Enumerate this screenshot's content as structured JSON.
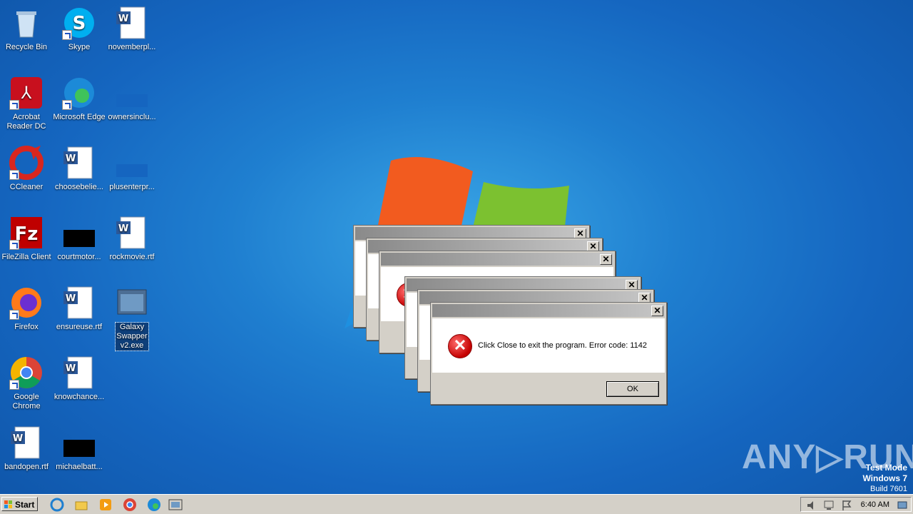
{
  "desktop_icons": [
    {
      "label": "Recycle Bin"
    },
    {
      "label": "Skype"
    },
    {
      "label": "novemberpl..."
    },
    {
      "label": "Acrobat Reader DC"
    },
    {
      "label": "Microsoft Edge"
    },
    {
      "label": "ownersinclu..."
    },
    {
      "label": "CCleaner"
    },
    {
      "label": "choosebelie..."
    },
    {
      "label": "plusenterpr..."
    },
    {
      "label": "FileZilla Client"
    },
    {
      "label": "courtmotor..."
    },
    {
      "label": "rockmovie.rtf"
    },
    {
      "label": "Firefox"
    },
    {
      "label": "ensureuse.rtf"
    },
    {
      "label": "Galaxy Swapper v2.exe"
    },
    {
      "label": "Google Chrome"
    },
    {
      "label": "knowchance..."
    },
    {
      "label": "bandopen.rtf"
    },
    {
      "label": "michaelbatt..."
    }
  ],
  "dialog": {
    "message": "Click Close to exit the program. Error code: 1142",
    "ok_label": "OK",
    "close_glyph": "✕"
  },
  "taskbar": {
    "start_label": "Start",
    "clock": "6:40 AM"
  },
  "watermark": {
    "line1": "Test Mode",
    "line2": "Windows 7",
    "line3": "Build 7601",
    "brand": "ANY▷RUN"
  },
  "colors": {
    "accent": "#1f7fd0",
    "error": "#c40000"
  }
}
